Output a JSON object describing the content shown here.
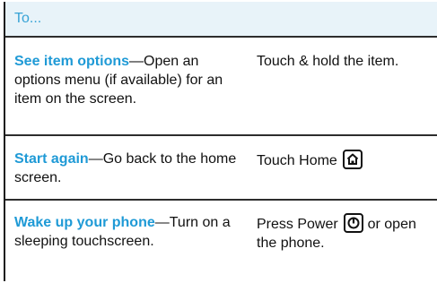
{
  "header": {
    "title": "To..."
  },
  "rows": [
    {
      "term": "See item options",
      "desc": "—Open an options menu (if available) for an item on the screen.",
      "action": "Touch & hold the item."
    },
    {
      "term": "Start again",
      "desc": "—Go back to the home screen.",
      "action": "Touch Home",
      "icon": "home-key-icon"
    },
    {
      "term": "Wake up your phone",
      "desc": "—Turn on a sleeping touchscreen.",
      "action_pre": "Press Power",
      "action_post": " or open the phone.",
      "icon": "power-key-icon"
    }
  ]
}
